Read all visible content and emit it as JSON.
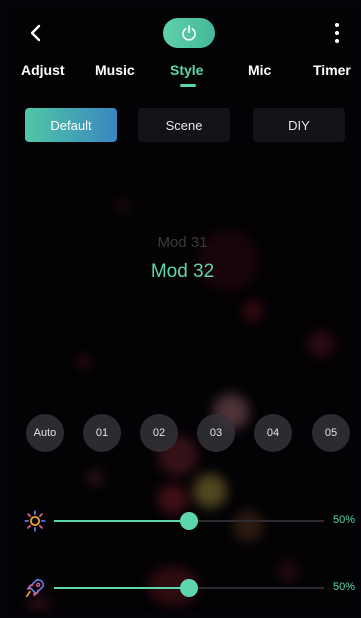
{
  "colors": {
    "accent": "#5ed6ad",
    "background": "#030205",
    "segment_active_from": "#4fc7a5",
    "segment_active_to": "#3a86c2"
  },
  "header": {
    "back_icon": "chevron-left-icon",
    "power_icon": "power-icon",
    "more_icon": "more-vertical-icon"
  },
  "tabs": [
    {
      "label": "Adjust",
      "active": false
    },
    {
      "label": "Music",
      "active": false
    },
    {
      "label": "Style",
      "active": true
    },
    {
      "label": "Mic",
      "active": false
    },
    {
      "label": "Timer",
      "active": false
    }
  ],
  "segments": {
    "default": "Default",
    "scene": "Scene",
    "diy": "DIY",
    "selected": "Default"
  },
  "mode_picker": {
    "previous": "Mod 31",
    "current": "Mod 32"
  },
  "presets": [
    "Auto",
    "01",
    "02",
    "03",
    "04",
    "05"
  ],
  "brightness": {
    "icon": "sun-icon",
    "value": 0.5,
    "label": "50%"
  },
  "speed": {
    "icon": "rocket-icon",
    "value": 0.5,
    "label": "50%"
  }
}
